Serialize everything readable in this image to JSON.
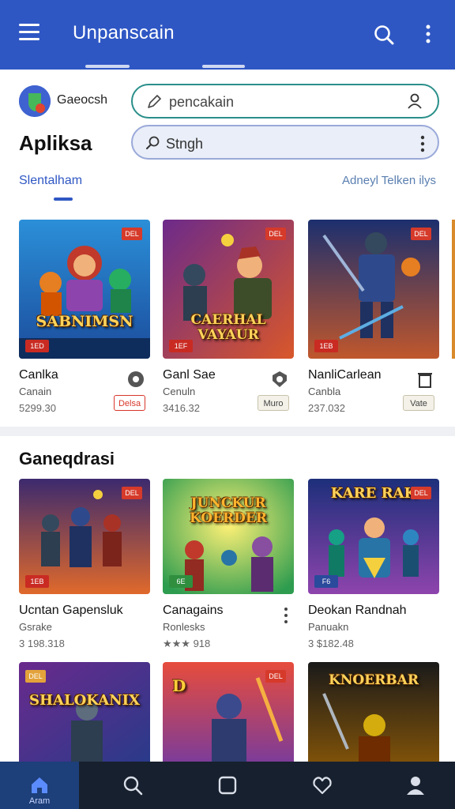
{
  "appbar": {
    "title": "Unpanscain"
  },
  "account": {
    "name": "Gaeocsh"
  },
  "heading": "Apliksa",
  "search": {
    "placeholder": "pencakain"
  },
  "filter": {
    "label": "Stngh"
  },
  "tabs": {
    "active": "Slentalham",
    "link": "Adneyl Telken ilys"
  },
  "row1": [
    {
      "title": "SABNIMSN",
      "name": "Canlka",
      "sub": "Canain",
      "price": "5299.30",
      "flag": "DEL",
      "badge": "1ED",
      "action_label": "Delsa"
    },
    {
      "title": "CAERHAL VAYAUR",
      "name": "Ganl Sae",
      "sub": "Cenuln",
      "price": "3416.32",
      "flag": "DEL",
      "badge": "1EF",
      "action_label": "Muro"
    },
    {
      "title": "",
      "name": "NanliCarlean",
      "sub": "Canbla",
      "price": "237.032",
      "flag": "DEL",
      "badge": "1EB",
      "action_label": "Vate"
    }
  ],
  "section2": {
    "title": "Ganeqdrasi"
  },
  "row2": [
    {
      "title": "",
      "name": "Ucntan Gapensluk",
      "sub": "Gsrake",
      "price": "3 198.318",
      "flag": "DEL",
      "badge": "1EB"
    },
    {
      "title": "JUNCKUR KOERDER",
      "name": "Canagains",
      "sub": "Ronlesks",
      "price": "★★★ 918",
      "flag": "",
      "badge": "6E"
    },
    {
      "title": "KARE RAK",
      "name": "Deokan Randnah",
      "sub": "Panuakn",
      "price": "3 $182.48",
      "flag": "DEL",
      "badge": "F6"
    }
  ],
  "row3": [
    {
      "title": "SHALOKANIX",
      "flag": "DEL",
      "badge": ""
    },
    {
      "title": "D",
      "flag": "DEL",
      "badge": ""
    },
    {
      "title": "KNOERBAR",
      "flag": "",
      "badge": ""
    }
  ],
  "bottomnav": {
    "home_label": "Aram"
  }
}
